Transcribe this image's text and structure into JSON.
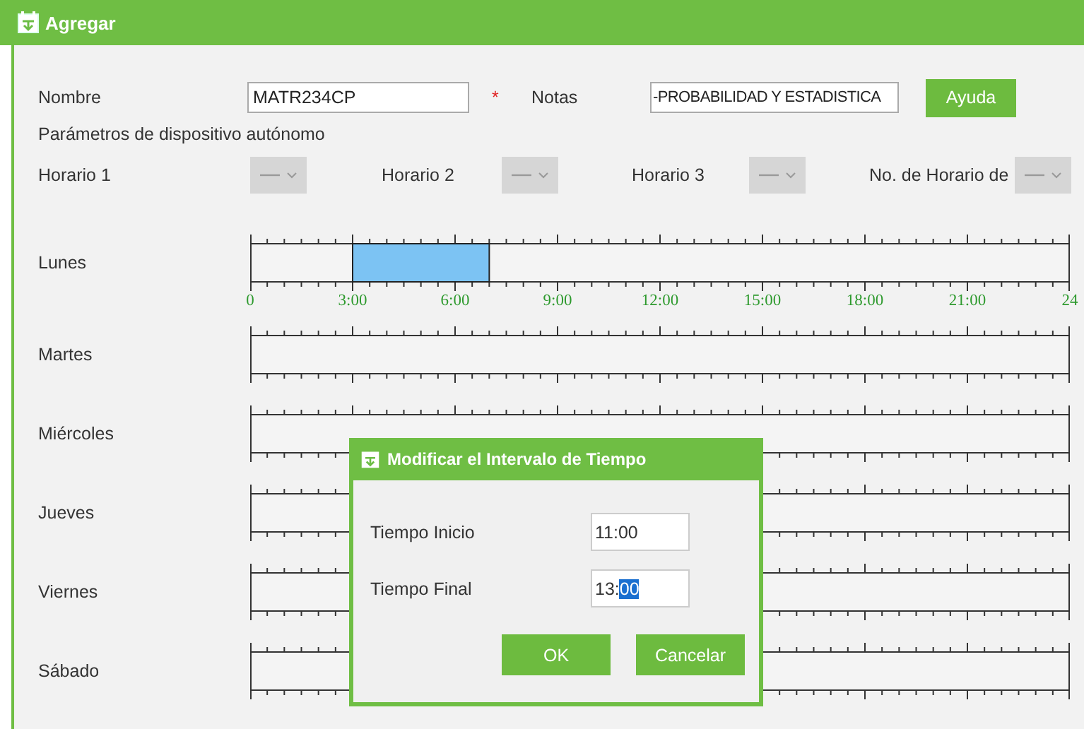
{
  "window": {
    "title": "Agregar"
  },
  "form": {
    "name_label": "Nombre",
    "name_value": "MATR234CP",
    "required_mark": "*",
    "notes_label": "Notas",
    "notes_value": "-PROBABILIDAD Y ESTADISTICA",
    "help_button": "Ayuda"
  },
  "section_title": "Parámetros de dispositivo autónomo",
  "schedules": [
    {
      "label": "Horario 1",
      "disabled": true
    },
    {
      "label": "Horario 2",
      "disabled": true
    },
    {
      "label": "Horario 3",
      "disabled": true
    },
    {
      "label": "No. de Horario de",
      "disabled": true
    }
  ],
  "days": [
    {
      "label": "Lunes",
      "axis_labels": [
        "0",
        "3:00",
        "6:00",
        "9:00",
        "12:00",
        "15:00",
        "18:00",
        "21:00",
        "24"
      ],
      "ranges": [
        {
          "start": {
            "level": 0.125
          },
          "span": {
            "level": 0.1667
          }
        }
      ]
    },
    {
      "label": "Martes"
    },
    {
      "label": "Miércoles"
    },
    {
      "label": "Jueves"
    },
    {
      "label": "Viernes"
    },
    {
      "label": "Sábado"
    }
  ],
  "dialog": {
    "title": "Modificar el Intervalo de Tiempo",
    "fields": [
      {
        "label": "Tiempo Inicio",
        "value": "11:00"
      },
      {
        "label": "Tiempo Final",
        "value": "13:",
        "selected_text": "00"
      }
    ],
    "buttons": [
      "OK",
      "Cancelar"
    ]
  }
}
